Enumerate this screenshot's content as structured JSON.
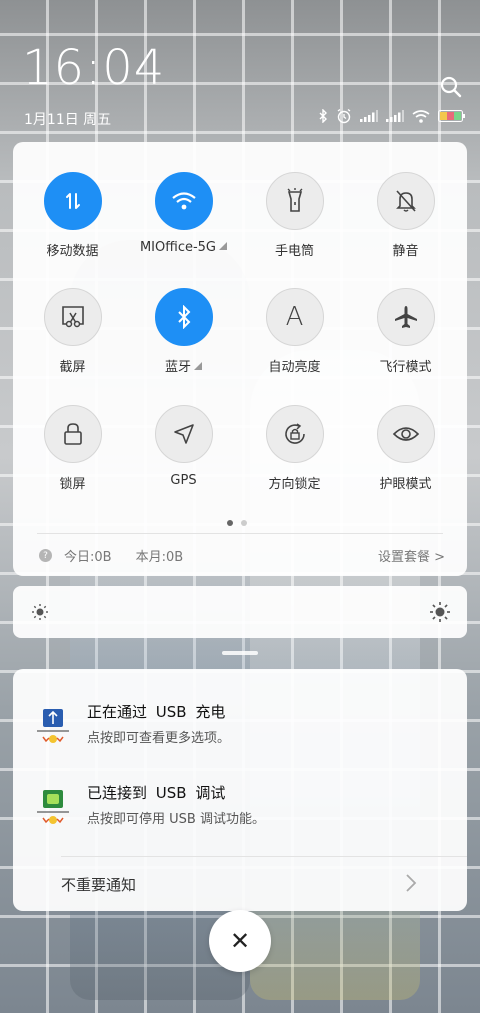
{
  "status_bar": {
    "time": "16:04",
    "date": "1月11日 周五",
    "icons": [
      "bluetooth-icon",
      "alarm-icon",
      "signal-icon",
      "signal-icon",
      "wifi-icon",
      "battery-icon"
    ]
  },
  "quick_settings": {
    "tiles": [
      {
        "label": "移动数据",
        "icon": "mobile-data-icon",
        "active": true
      },
      {
        "label": "MIOffice-5G",
        "icon": "wifi-icon",
        "active": true
      },
      {
        "label": "手电筒",
        "icon": "flashlight-icon",
        "active": false
      },
      {
        "label": "静音",
        "icon": "bell-off-icon",
        "active": false
      },
      {
        "label": "截屏",
        "icon": "screenshot-icon",
        "active": false
      },
      {
        "label": "蓝牙",
        "icon": "bluetooth-icon",
        "active": true
      },
      {
        "label": "自动亮度",
        "icon": "auto-brightness-icon",
        "active": false
      },
      {
        "label": "飞行模式",
        "icon": "airplane-icon",
        "active": false
      },
      {
        "label": "锁屏",
        "icon": "lock-icon",
        "active": false
      },
      {
        "label": "GPS",
        "icon": "gps-icon",
        "active": false
      },
      {
        "label": "方向锁定",
        "icon": "rotation-lock-icon",
        "active": false
      },
      {
        "label": "护眼模式",
        "icon": "eye-icon",
        "active": false
      }
    ],
    "auto_brightness_glyph": "A",
    "page_count": 2,
    "current_page": 1,
    "data_usage": {
      "today": "今日:0B",
      "month": "本月:0B",
      "plan_link": "设置套餐 >"
    }
  },
  "colors": {
    "accent": "#1e8ff5"
  },
  "notifications": [
    {
      "title": "正在通过 USB 充电",
      "subtitle": "点按即可查看更多选项。",
      "icon": "usb-charging-icon"
    },
    {
      "title": "已连接到 USB 调试",
      "subtitle": "点按即可停用 USB 调试功能。",
      "icon": "usb-debug-icon"
    }
  ],
  "minor_notifications_label": "不重要通知",
  "close_button_glyph": "✕"
}
